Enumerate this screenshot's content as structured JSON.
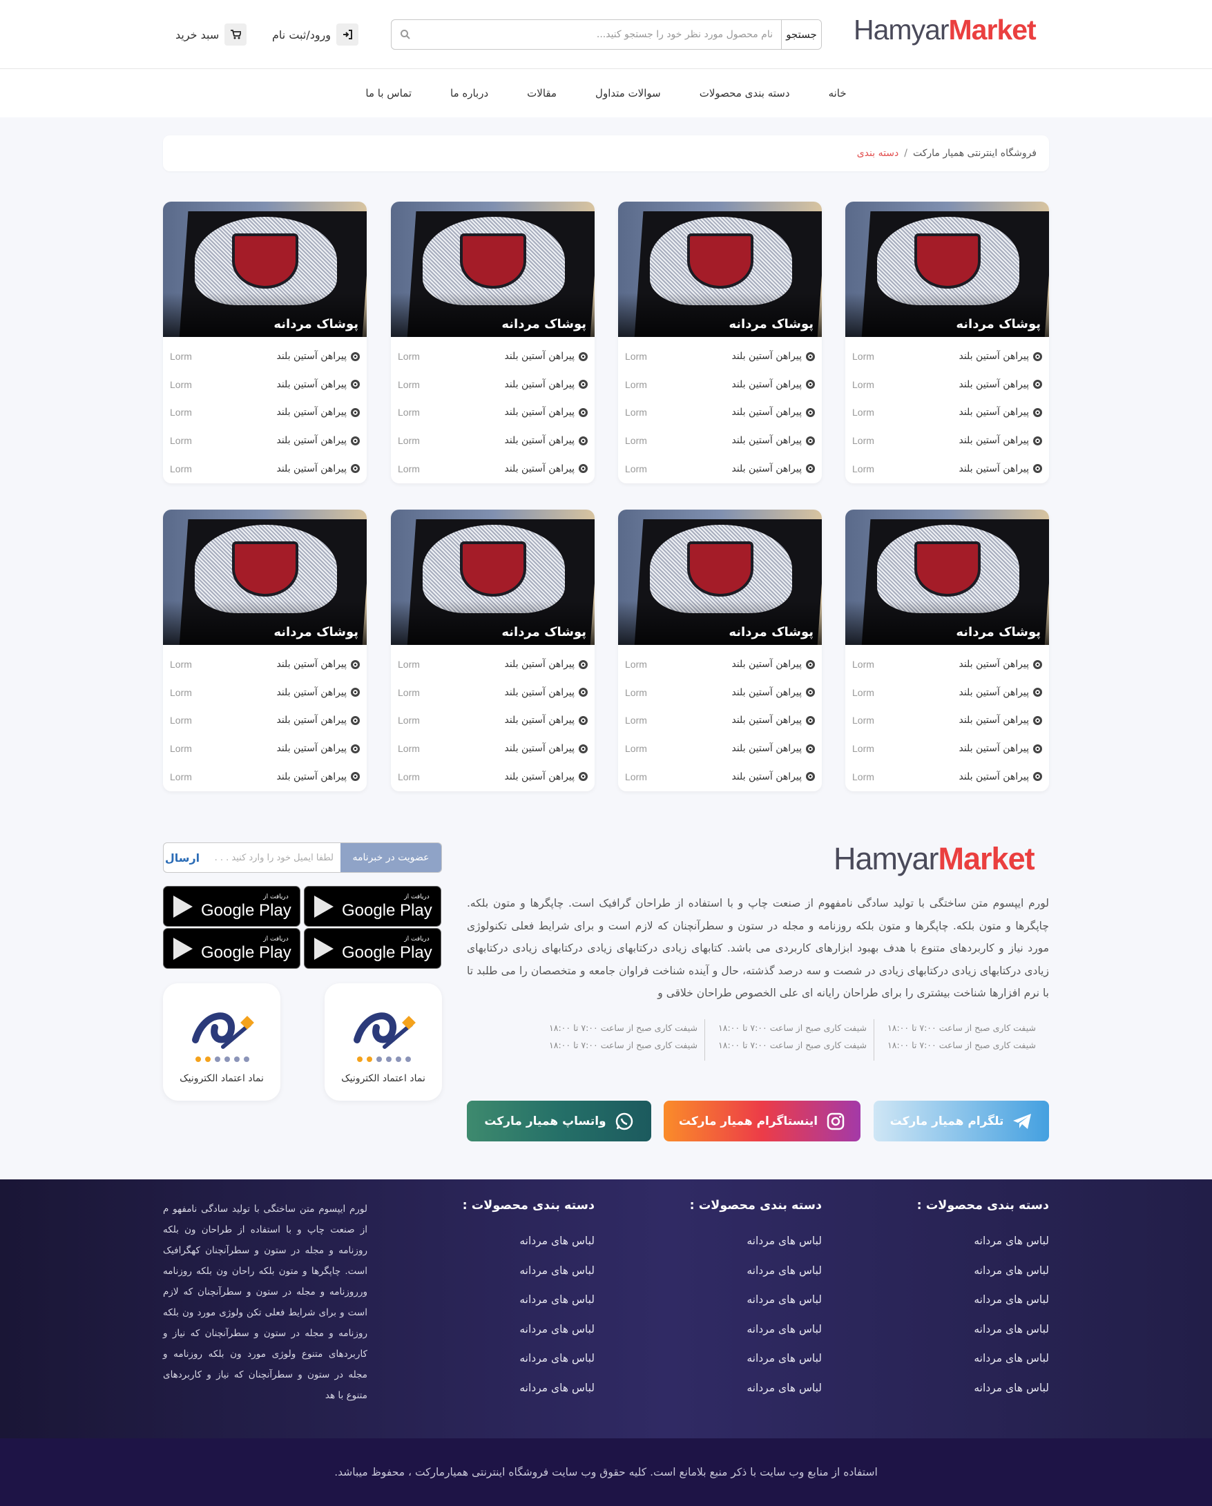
{
  "header": {
    "logo_part1": "Hamyar",
    "logo_part2": "Market",
    "search_button": "جستجو",
    "search_placeholder": "نام محصول مورد نظر خود را جستجو کنید...",
    "login_label": "ورود/ثبت نام",
    "cart_label": "سبد خرید",
    "icons": [
      "search-icon",
      "login-icon",
      "cart-icon"
    ]
  },
  "nav": {
    "items": [
      "خانه",
      "دسته بندی محصولات",
      "سوالات متداول",
      "مقالات",
      "درباره ما",
      "تماس با ما"
    ]
  },
  "breadcrumb": {
    "home": "فروشگاه اینترنتی همیار مارکت",
    "separator": "/",
    "current": "دسته بندی"
  },
  "categories": {
    "card_title": "پوشاک مردانه",
    "item_label": "پیراهن آستین بلند",
    "item_value": "Lorm",
    "items_per_card": 5,
    "rows": 2,
    "cards_per_row": 4
  },
  "footer_info": {
    "logo_part1": "Hamyar",
    "logo_part2": "Market",
    "about": "لورم ایپسوم متن ساختگی با تولید سادگی نامفهوم از صنعت چاپ و با استفاده از طراحان گرافیک است. چاپگرها و متون بلکه. چاپگرها و متون بلکه. چاپگرها و متون بلکه روزنامه و مجله در ستون و سطرآنچنان که لازم است و برای شرایط فعلی تکنولوژی مورد نیاز و کاربردهای متنوع با هدف بهبود ابزارهای کاربردی می باشد. کتابهای زیادی درکتابهای زیادی درکتابهای زیادی درکتابهای زیادی درکتابهای زیادی درکتابهای زیادی در شصت و سه درصد گذشته، حال و آینده شناخت فراوان جامعه و متخصصان را می طلبد تا با نرم افزارها شناخت بیشتری را برای طراحان رایانه ای علی الخصوص طراحان خلاقی و",
    "shift_text": "شیفت کاری صبح از ساعت ۷:۰۰ تا ۱۸:۰۰",
    "telegram": "تلگرام همیار مارکت",
    "instagram": "اینستاگرام همیار مارکت",
    "whatsapp": "واتساپ همیار مارکت",
    "newsletter_label": "عضویت در خبرنامه",
    "newsletter_placeholder": "لطفا ایمیل خود را وارد کنید . . .",
    "newsletter_send": "ارسال",
    "gp_small": "دریافت از",
    "gp_big": "Google Play",
    "trust_label": "نماد اعتماد الکترونیک"
  },
  "footer": {
    "col_title": "دسته بندی محصولات :",
    "col_item": "لباس های مردانه",
    "items_per_col": 6,
    "text": "لورم ایپسوم متن ساختگی با تولید سادگی نامفهو م از صنعت چاپ و با استفاده از طراحان ون بلکه روزنامه و مجله در ستون و سطرآنچنان کهگرافیک است. چاپگرها و متون بلکه راحان ون بلکه روزنامه ورروزنامه و مجله در ستون و سطرآنچنان که لازم است و برای شرایط فعلی تکن ولوژی مورد ون بلکه روزنامه و مجله در ستون و سطرآنچنان که نیاز و کاربردهای متنوع ولوژی مورد ون بلکه روزنامه و مجله در ستون و سطرآنچنان که نیاز و کاربردهای متنوع با هد",
    "copyright": "استفاده از منابع وب سایت با ذکر منبع بلامانع است. کلیه حقوق وب سایت فروشگاه اینترنتی همیارمارکت ، محفوظ میباشد."
  },
  "colors": {
    "brand_red": "#ea3f3f",
    "brand_gray": "#4a4a5a",
    "footer_dark": "#1e1446",
    "newsletter_blue": "#8fa3c7"
  }
}
